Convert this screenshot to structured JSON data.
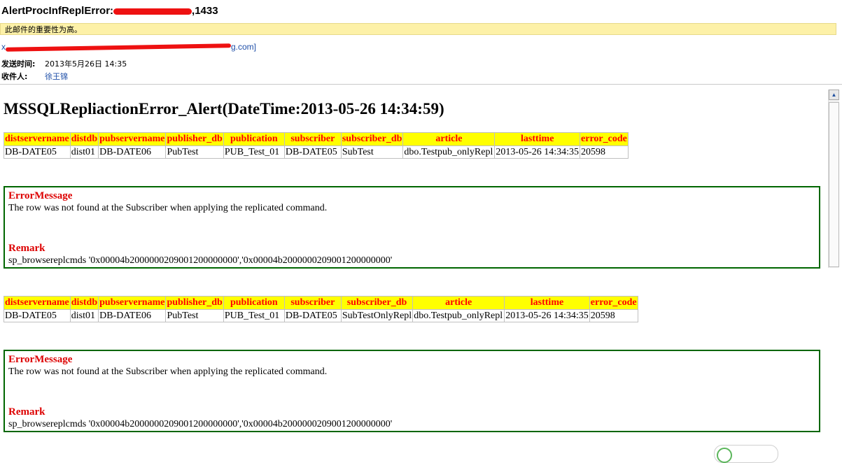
{
  "header": {
    "subject_prefix": "AlertProcInfReplError:",
    "subject_suffix": ",1433",
    "importance_notice": "此邮件的重要性为高。",
    "sender_start": "x",
    "sender_end": "g.com]",
    "sent_label": "发送时间:",
    "sent_value": "2013年5月26日  14:35",
    "to_label": "收件人:",
    "to_value": "徐王锦"
  },
  "body": {
    "title": "MSSQLRepliactionError_Alert(DateTime:2013-05-26 14:34:59)",
    "columns": [
      "distservername",
      "distdb",
      "pubservername",
      "publisher_db",
      "publication",
      "subscriber",
      "subscriber_db",
      "article",
      "lasttime",
      "error_code"
    ],
    "records": [
      {
        "row": [
          "DB-DATE05",
          "dist01",
          "DB-DATE06",
          "PubTest",
          "PUB_Test_01",
          "DB-DATE05",
          "SubTest",
          "dbo.Testpub_onlyRepl",
          "2013-05-26 14:34:35",
          "20598"
        ],
        "error_heading": "ErrorMessage",
        "error_text": "The row was not found at the Subscriber when applying the replicated command.",
        "remark_heading": "Remark",
        "remark_text": "sp_browsereplcmds '0x00004b2000000209001200000000','0x00004b2000000209001200000000'"
      },
      {
        "row": [
          "DB-DATE05",
          "dist01",
          "DB-DATE06",
          "PubTest",
          "PUB_Test_01",
          "DB-DATE05",
          "SubTestOnlyRepl",
          "dbo.Testpub_onlyRepl",
          "2013-05-26 14:34:35",
          "20598"
        ],
        "error_heading": "ErrorMessage",
        "error_text": "The row was not found at the Subscriber when applying the replicated command.",
        "remark_heading": "Remark",
        "remark_text": "sp_browsereplcmds '0x00004b2000000209001200000000','0x00004b2000000209001200000000'"
      }
    ]
  },
  "colors": {
    "header_bg": "#ffff00",
    "header_text": "#ff0000",
    "border": "#006600",
    "notice_bg": "#fdf1a8"
  },
  "icons": {
    "scroll_up": "triangle-up-icon"
  }
}
